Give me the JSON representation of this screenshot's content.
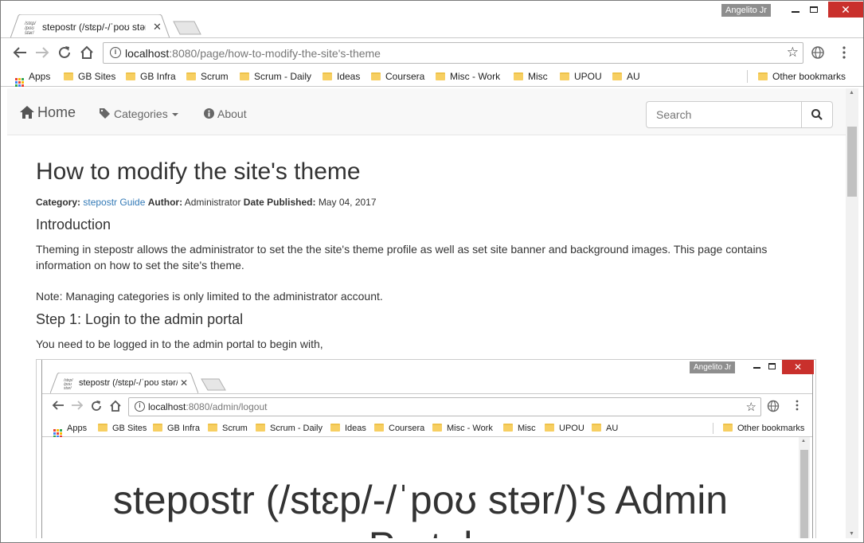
{
  "window": {
    "user": "Angelito Jr",
    "tab_title": "stepostr (/stɛp/-/ˈpoʊ stər/)'s Help Page",
    "favicon_text": "/stɛp/ /poʊ stər/",
    "close_glyph": "✕"
  },
  "toolbar": {
    "url_host": "localhost",
    "url_path": ":8080/page/how-to-modify-the-site's-theme"
  },
  "bookmarks": {
    "apps": "Apps",
    "items": [
      "GB Sites",
      "GB Infra",
      "Scrum",
      "Scrum - Daily",
      "Ideas",
      "Coursera",
      "Misc - Work",
      "Misc",
      "UPOU",
      "AU"
    ],
    "other": "Other bookmarks"
  },
  "navbar": {
    "brand": "Home",
    "categories": "Categories",
    "about": "About",
    "search_placeholder": "Search"
  },
  "article": {
    "title": "How to modify the site's theme",
    "category_label": "Category:",
    "category_value": "stepostr Guide",
    "author_label": "Author:",
    "author_value": "Administrator",
    "date_label": "Date Published:",
    "date_value": "May 04, 2017",
    "intro_heading": "Introduction",
    "intro_text": "Theming in stepostr allows the administrator to set the the site's theme profile as well as set site banner and background images. This page contains information on how to set the site's theme.",
    "note": "Note: Managing categories is only limited to the administrator account.",
    "step1_heading": "Step 1: Login to the admin portal",
    "step1_text": "You need to be logged in to the admin portal to begin with,"
  },
  "screenshot": {
    "user": "Angelito Jr",
    "tab_title": "stepostr (/stɛp/-/ˈpoʊ stər/)'s Admin Portal",
    "url_host": "localhost",
    "url_path": ":8080/admin/logout",
    "heading_line1": "stepostr (/stɛp/-/ˈpoʊ stər/)'s Admin",
    "heading_line2": "Portal"
  },
  "colors": {
    "link": "#337ab7",
    "close_button": "#c9302c",
    "folder": "#f7cf62"
  }
}
